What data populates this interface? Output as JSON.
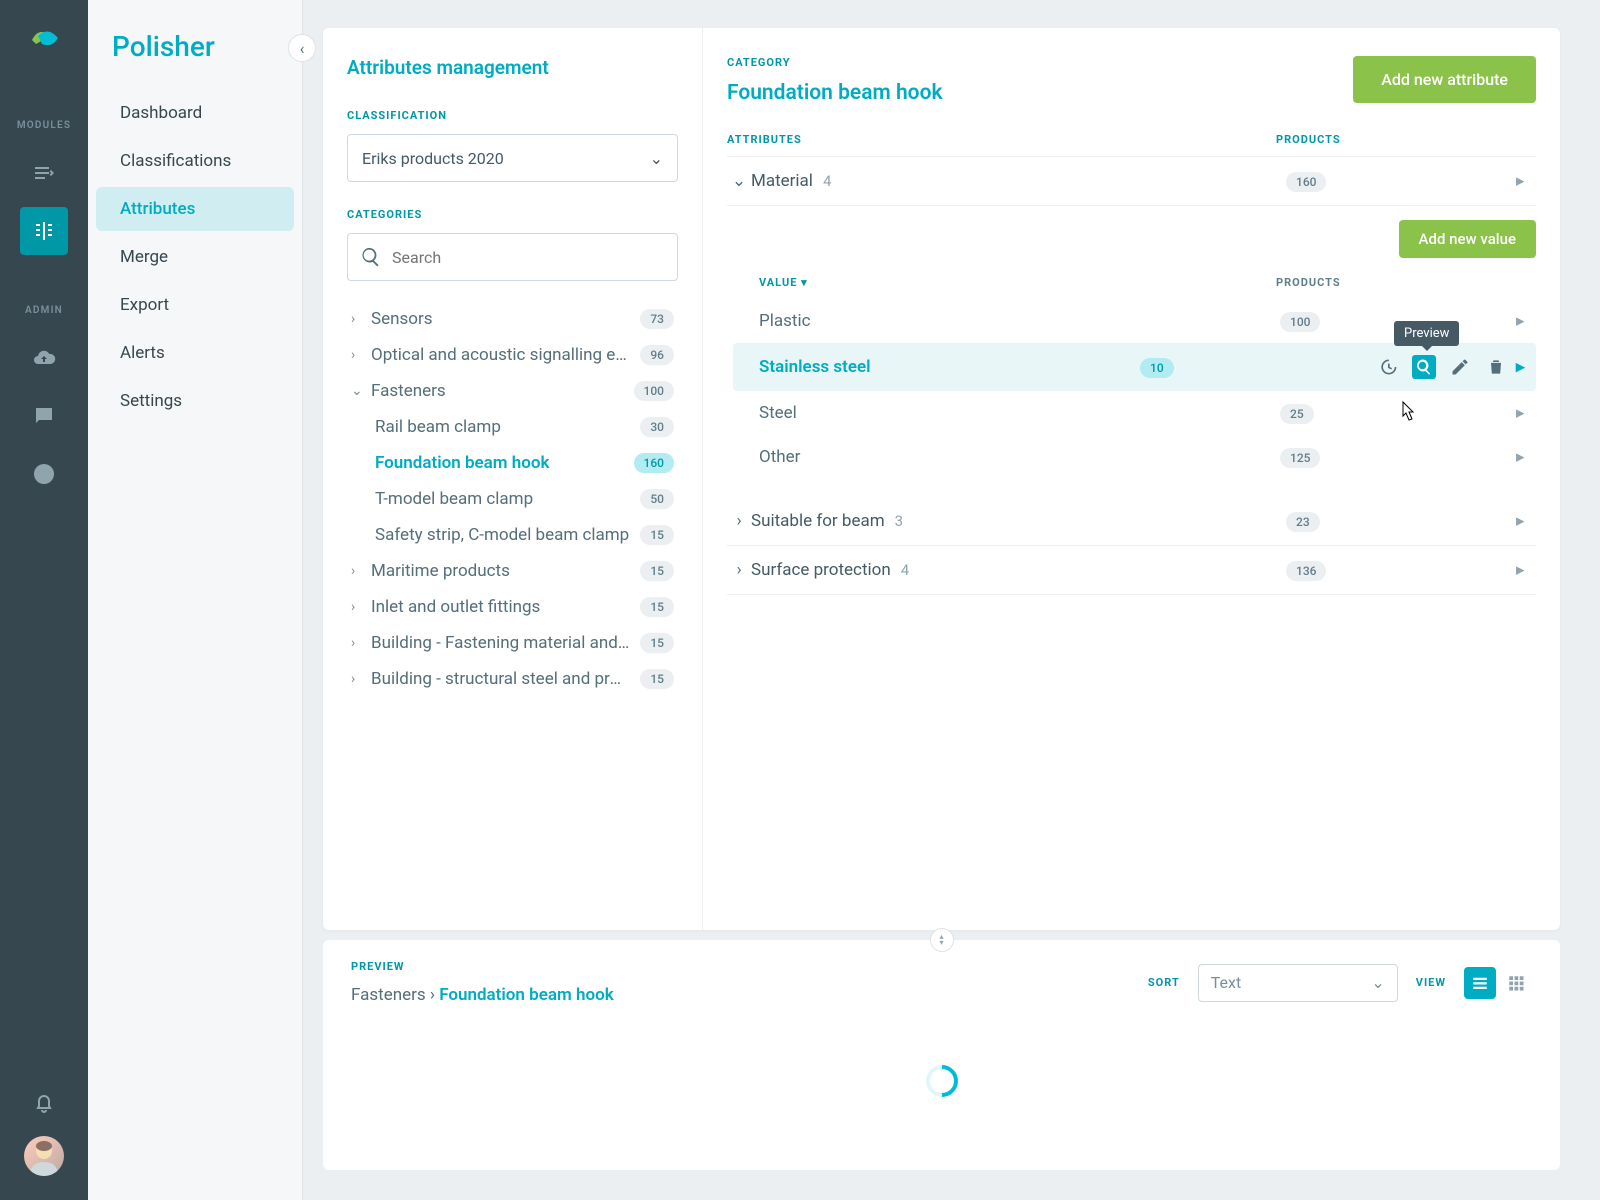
{
  "rail": {
    "modules_label": "MODULES",
    "admin_label": "ADMIN"
  },
  "app": {
    "title": "Polisher"
  },
  "nav": {
    "items": [
      {
        "label": "Dashboard"
      },
      {
        "label": "Classifications"
      },
      {
        "label": "Attributes"
      },
      {
        "label": "Merge"
      },
      {
        "label": "Export"
      },
      {
        "label": "Alerts"
      },
      {
        "label": "Settings"
      }
    ]
  },
  "page": {
    "title": "Attributes management",
    "classification_label": "CLASSIFICATION",
    "classification_value": "Eriks products 2020",
    "categories_label": "CATEGORIES",
    "search_placeholder": "Search"
  },
  "tree": [
    {
      "label": "Sensors",
      "count": "73",
      "expanded": false
    },
    {
      "label": "Optical and acoustic signalling equi…",
      "count": "96",
      "expanded": false
    },
    {
      "label": "Fasteners",
      "count": "100",
      "expanded": true,
      "children": [
        {
          "label": "Rail beam clamp",
          "count": "30"
        },
        {
          "label": "Foundation beam hook",
          "count": "160",
          "active": true
        },
        {
          "label": "T-model beam clamp",
          "count": "50"
        },
        {
          "label": "Safety strip, C-model beam clamp",
          "count": "15"
        }
      ]
    },
    {
      "label": "Maritime products",
      "count": "15",
      "expanded": false
    },
    {
      "label": "Inlet and outlet fittings",
      "count": "15",
      "expanded": false
    },
    {
      "label": "Building - Fastening material and to…",
      "count": "15",
      "expanded": false
    },
    {
      "label": "Building - structural steel and profil…",
      "count": "15",
      "expanded": false
    }
  ],
  "right": {
    "category_label": "CATEGORY",
    "category_name": "Foundation beam hook",
    "add_attr_btn": "Add new attribute",
    "attrs_label": "ATTRIBUTES",
    "products_label": "PRODUCTS",
    "add_value_btn": "Add new value",
    "value_col": "Value",
    "products_col": "Products",
    "tooltip": "Preview",
    "attributes": [
      {
        "name": "Material",
        "options": "4",
        "products": "160",
        "expanded": true,
        "values": [
          {
            "name": "Plastic",
            "count": "100"
          },
          {
            "name": "Stainless steel",
            "count": "10",
            "active": true
          },
          {
            "name": "Steel",
            "count": "25"
          },
          {
            "name": "Other",
            "count": "125"
          }
        ]
      },
      {
        "name": "Suitable for beam",
        "options": "3",
        "products": "23",
        "expanded": false
      },
      {
        "name": "Surface protection",
        "options": "4",
        "products": "136",
        "expanded": false
      }
    ]
  },
  "preview": {
    "label": "PREVIEW",
    "crumb_parent": "Fasteners",
    "crumb_current": "Foundation beam hook",
    "sort_label": "SORT",
    "sort_value": "Text",
    "view_label": "VIEW"
  }
}
